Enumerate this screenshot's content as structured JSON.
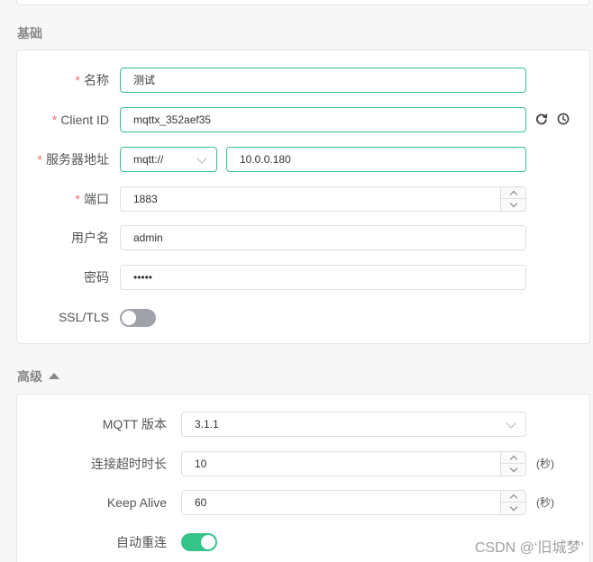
{
  "sections": {
    "basic_title": "基础",
    "advanced_title": "高级"
  },
  "basic": {
    "name": {
      "label": "名称",
      "required_mark": "*",
      "value": "测试"
    },
    "client_id": {
      "label": "Client ID",
      "required_mark": "*",
      "value": "mqttx_352aef35"
    },
    "host": {
      "label": "服务器地址",
      "required_mark": "*",
      "protocol": "mqtt://",
      "value": "10.0.0.180"
    },
    "port": {
      "label": "端口",
      "required_mark": "*",
      "value": "1883"
    },
    "username": {
      "label": "用户名",
      "value": "admin"
    },
    "password": {
      "label": "密码",
      "value": "•••••"
    },
    "ssl": {
      "label": "SSL/TLS",
      "enabled": false
    }
  },
  "advanced": {
    "mqtt_version": {
      "label": "MQTT 版本",
      "value": "3.1.1"
    },
    "connect_timeout": {
      "label": "连接超时时长",
      "value": "10",
      "unit": "(秒)"
    },
    "keep_alive": {
      "label": "Keep Alive",
      "value": "60",
      "unit": "(秒)"
    },
    "auto_reconnect": {
      "label": "自动重连",
      "enabled": true
    }
  },
  "icons": {
    "refresh": "refresh-icon",
    "clock": "clock-icon",
    "collapse": "caret-up-icon"
  },
  "colors": {
    "accent": "#34c388",
    "required": "#f56c6c",
    "toggle_off": "#9fa3a9"
  },
  "watermark": "CSDN @‘旧城梦’"
}
